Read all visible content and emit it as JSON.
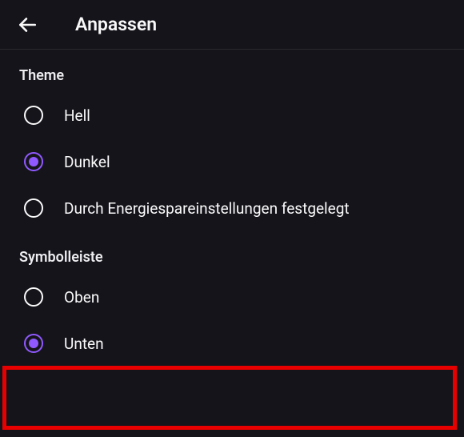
{
  "header": {
    "title": "Anpassen"
  },
  "sections": {
    "theme": {
      "header": "Theme",
      "options": {
        "light": "Hell",
        "dark": "Dunkel",
        "auto": "Durch Energiespareinstellungen festgelegt"
      },
      "selected": "dark"
    },
    "toolbar": {
      "header": "Symbolleiste",
      "options": {
        "top": "Oben",
        "bottom": "Unten"
      },
      "selected": "bottom"
    }
  },
  "highlight": {
    "target": "toolbar.bottom"
  },
  "colors": {
    "accent": "#9059ff",
    "background": "#15141a",
    "text": "#f9f9fa",
    "highlight_border": "#e80000"
  }
}
